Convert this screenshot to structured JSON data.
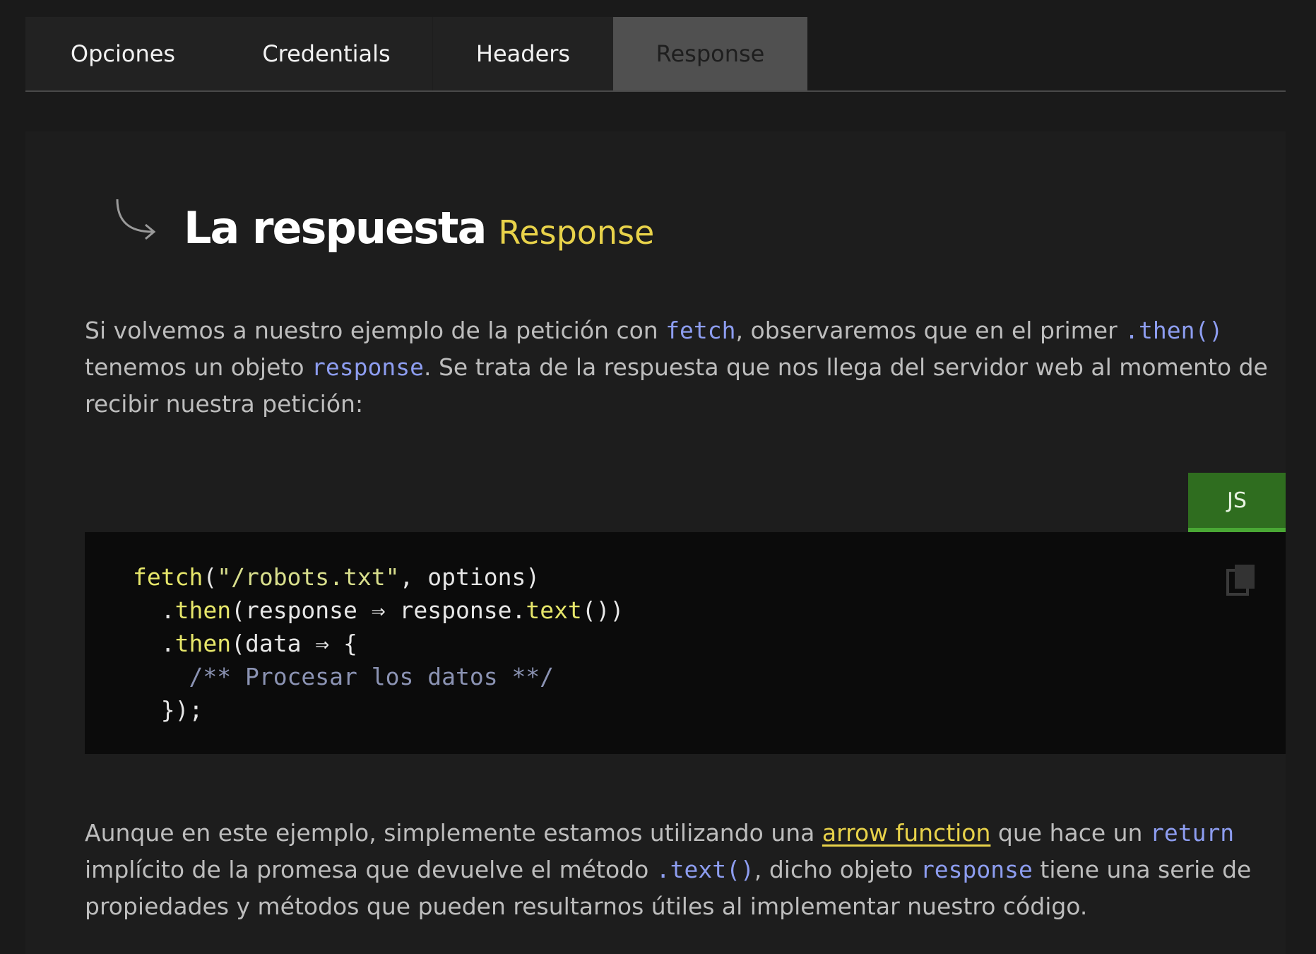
{
  "tabs": [
    {
      "label": "Opciones"
    },
    {
      "label": "Credentials"
    },
    {
      "label": "Headers"
    },
    {
      "label": "Response"
    }
  ],
  "heading": {
    "title": "La respuesta",
    "subtitle": "Response"
  },
  "para1": {
    "t1": "Si volvemos a nuestro ejemplo de la petición con ",
    "c1": "fetch",
    "t2": ", observaremos que en el primer ",
    "c2": ".then()",
    "t3": " tenemos un objeto ",
    "c3": "response",
    "t4": ". Se trata de la respuesta que nos llega del servidor web al momento de recibir nuestra petición:"
  },
  "code": {
    "language": "JS",
    "l1_fn": "fetch",
    "l1_open": "(",
    "l1_str": "\"/robots.txt\"",
    "l1_rest": ", options)",
    "l2_indent": "  .",
    "l2_fn": "then",
    "l2_a": "(response ⇒ response.",
    "l2_fn2": "text",
    "l2_b": "())",
    "l3_indent": "  .",
    "l3_fn": "then",
    "l3_a": "(data ⇒ {",
    "l4_indent": "    ",
    "l4_cmt": "/** Procesar los datos **/",
    "l5": "  });"
  },
  "para2": {
    "t1": "Aunque en este ejemplo, simplemente estamos utilizando una ",
    "link": "arrow function",
    "t2": " que hace un ",
    "c1": "return",
    "t3": " implícito de la promesa que devuelve el método ",
    "c2": ".text()",
    "t4": ", dicho objeto ",
    "c3": "response",
    "t5": " tiene una serie de propiedades y métodos que pueden resultarnos útiles al implementar nuestro código."
  },
  "colors": {
    "accent_yellow": "#e8d24a",
    "inline_code": "#8d9df0",
    "badge_green": "#2f6d1f"
  }
}
